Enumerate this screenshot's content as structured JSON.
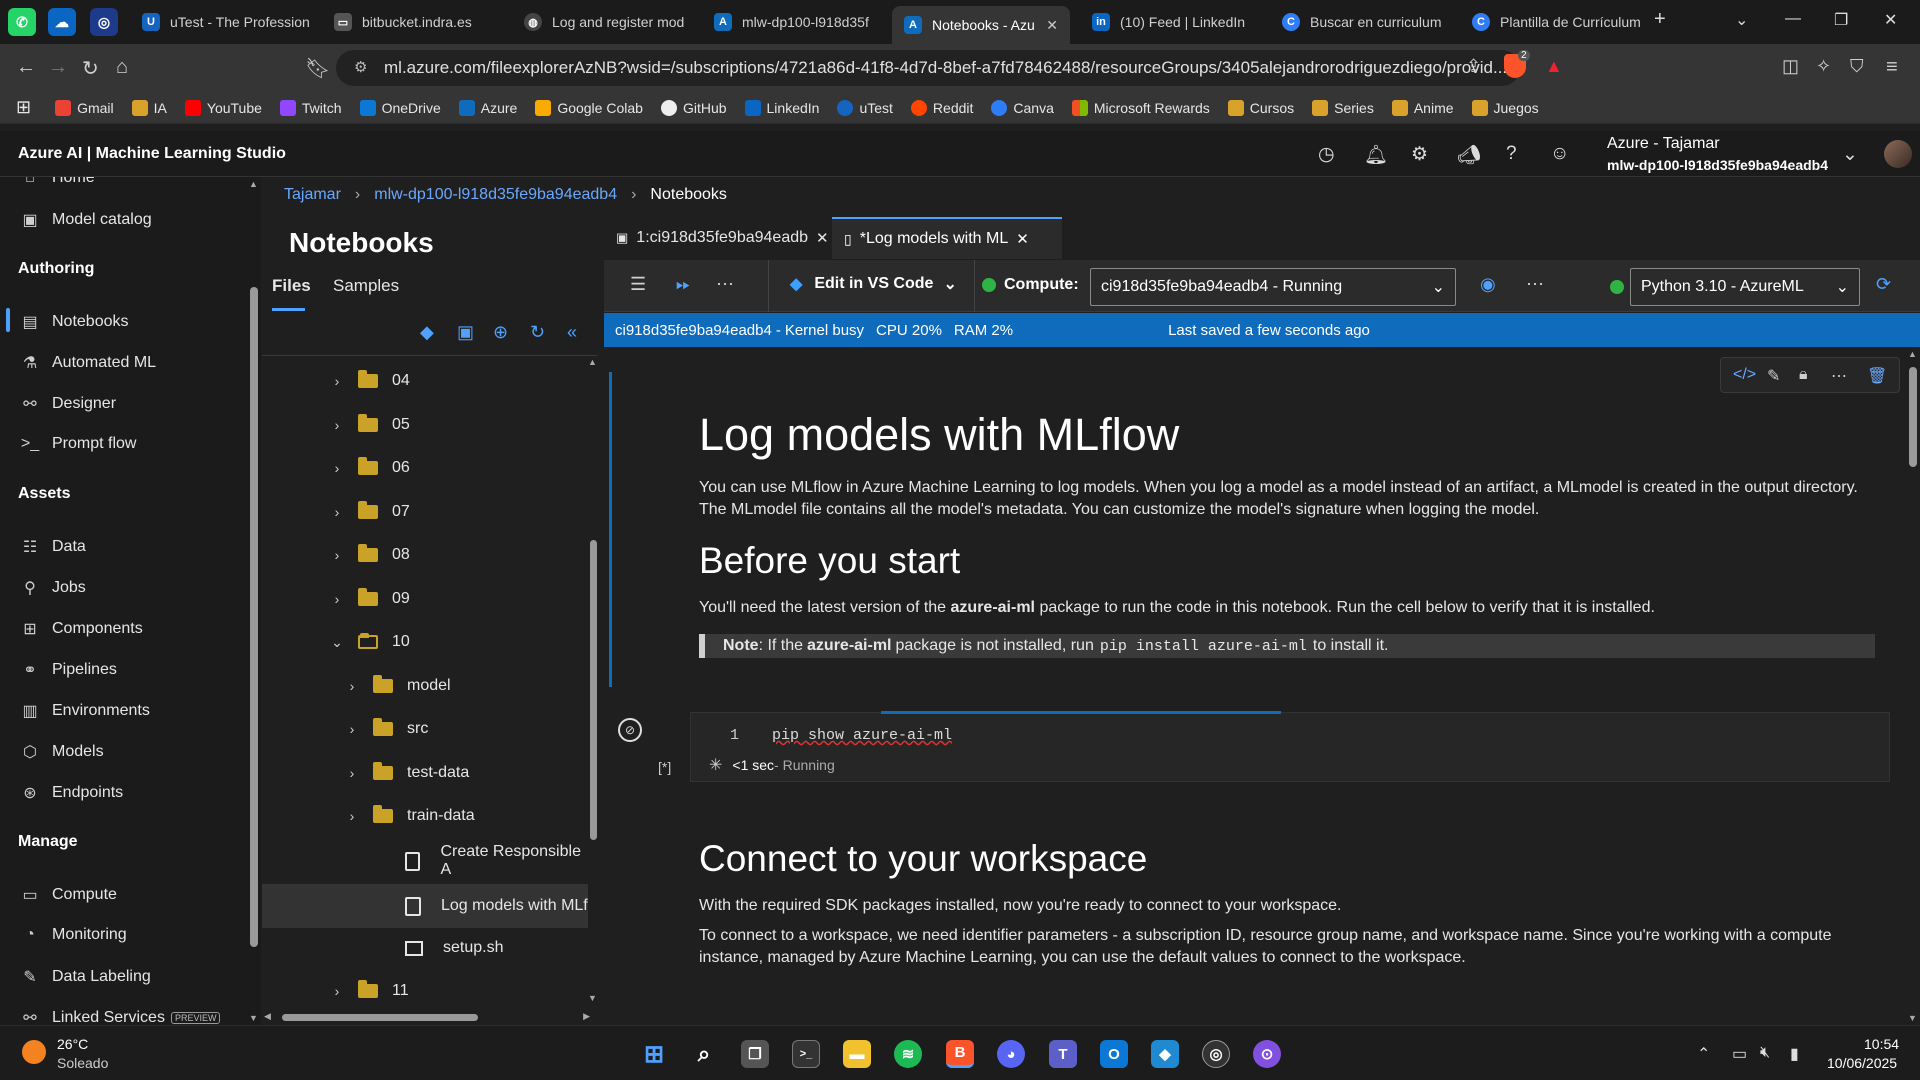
{
  "browser": {
    "tabs": [
      {
        "label": "uTest - The Profession",
        "icon": "utest-icon"
      },
      {
        "label": "bitbucket.indra.es",
        "icon": "bitbucket-icon"
      },
      {
        "label": "Log and register mod",
        "icon": "globe-icon"
      },
      {
        "label": "mlw-dp100-l918d35f",
        "icon": "azure-icon"
      },
      {
        "label": "Notebooks - Azu",
        "icon": "azure-icon",
        "active": true
      },
      {
        "label": "(10) Feed | LinkedIn",
        "icon": "linkedin-icon"
      },
      {
        "label": "Buscar en curriculum",
        "icon": "canva-icon"
      },
      {
        "label": "Plantilla de Currículum",
        "icon": "canva-icon"
      }
    ],
    "url": "ml.azure.com/fileexplorerAzNB?wsid=/subscriptions/4721a86d-41f8-4d7d-8bef-a7fd78462488/resourceGroups/3405alejandrorodriguezdiego/provid...",
    "brave_badge": "2",
    "bookmarks": [
      "Gmail",
      "IA",
      "YouTube",
      "Twitch",
      "OneDrive",
      "Azure",
      "Google Colab",
      "GitHub",
      "LinkedIn",
      "uTest",
      "Reddit",
      "Canva",
      "Microsoft Rewards",
      "Cursos",
      "Series",
      "Anime",
      "Juegos"
    ]
  },
  "app": {
    "title": "Azure AI | Machine Learning Studio",
    "account_name": "Azure - Tajamar",
    "workspace": "mlw-dp100-l918d35fe9ba94eadb4"
  },
  "nav": {
    "home": "Home",
    "model_catalog": "Model catalog",
    "authoring": "Authoring",
    "notebooks": "Notebooks",
    "automated_ml": "Automated ML",
    "designer": "Designer",
    "prompt_flow": "Prompt flow",
    "assets": "Assets",
    "data": "Data",
    "jobs": "Jobs",
    "components": "Components",
    "pipelines": "Pipelines",
    "environments": "Environments",
    "models": "Models",
    "endpoints": "Endpoints",
    "manage": "Manage",
    "compute": "Compute",
    "monitoring": "Monitoring",
    "data_labeling": "Data Labeling",
    "linked_services": "Linked Services",
    "preview": "PREVIEW"
  },
  "breadcrumb": {
    "root": "Tajamar",
    "workspace": "mlw-dp100-l918d35fe9ba94eadb4",
    "current": "Notebooks"
  },
  "files_pane": {
    "title": "Notebooks",
    "tab_files": "Files",
    "tab_samples": "Samples",
    "tree": {
      "f04": "04",
      "f05": "05",
      "f06": "06",
      "f07": "07",
      "f08": "08",
      "f09": "09",
      "f10": "10",
      "model": "model",
      "src": "src",
      "test_data": "test-data",
      "train_data": "train-data",
      "create_rai": "Create Responsible A",
      "log_models": "Log models with MLf",
      "setup": "setup.sh",
      "f11": "11"
    }
  },
  "editor": {
    "tab1": "1:ci918d35fe9ba94eadb",
    "tab2": "*Log models with ML",
    "edit_vscode": "Edit in VS Code",
    "compute_label": "Compute:",
    "compute_value": "ci918d35fe9ba94eadb4   -   Running",
    "kernel": "Python 3.10 - AzureML",
    "status": {
      "instance": "ci918d35fe9ba94eadb4",
      "kernel": "Kernel busy",
      "cpu": "CPU 20%",
      "ram": "RAM  2%",
      "saved": "Last saved a few seconds ago"
    }
  },
  "notebook": {
    "h1": "Log models with MLflow",
    "intro": "You can use MLflow in Azure Machine Learning to log models. When you log a model as a model instead of an artifact, a MLmodel is created in the output directory. The MLmodel file contains all the model's metadata. You can customize the model's signature when logging the model.",
    "h2_start": "Before you start",
    "start_a": "You'll need the latest version of the ",
    "start_pkg": "azure-ai-ml",
    "start_b": " package to run the code in this notebook. Run the cell below to verify that it is installed.",
    "note_label": "Note",
    "note_a": ": If the ",
    "note_pkg": "azure-ai-ml",
    "note_b": " package is not installed, run ",
    "note_cmd": "pip install azure-ai-ml",
    "note_c": " to install it.",
    "cell_line_no": "1",
    "cell_code": "pip show azure-ai-ml",
    "cell_exec": "[*]",
    "cell_time": "<1 sec",
    "cell_state": " - Running",
    "h2_connect": "Connect to your workspace",
    "connect_p1": "With the required SDK packages installed, now you're ready to connect to your workspace.",
    "connect_p2": "To connect to a workspace, we need identifier parameters - a subscription ID, resource group name, and workspace name. Since you're working with a compute instance, managed by Azure Machine Learning, you can use the default values to connect to the workspace."
  },
  "taskbar": {
    "weather_temp": "26°C",
    "weather_desc": "Soleado",
    "time": "10:54",
    "date": "10/06/2025"
  },
  "colors": {
    "accent": "#4ea1ff",
    "status_bar": "#0f6cbd",
    "running": "#2fb344"
  }
}
